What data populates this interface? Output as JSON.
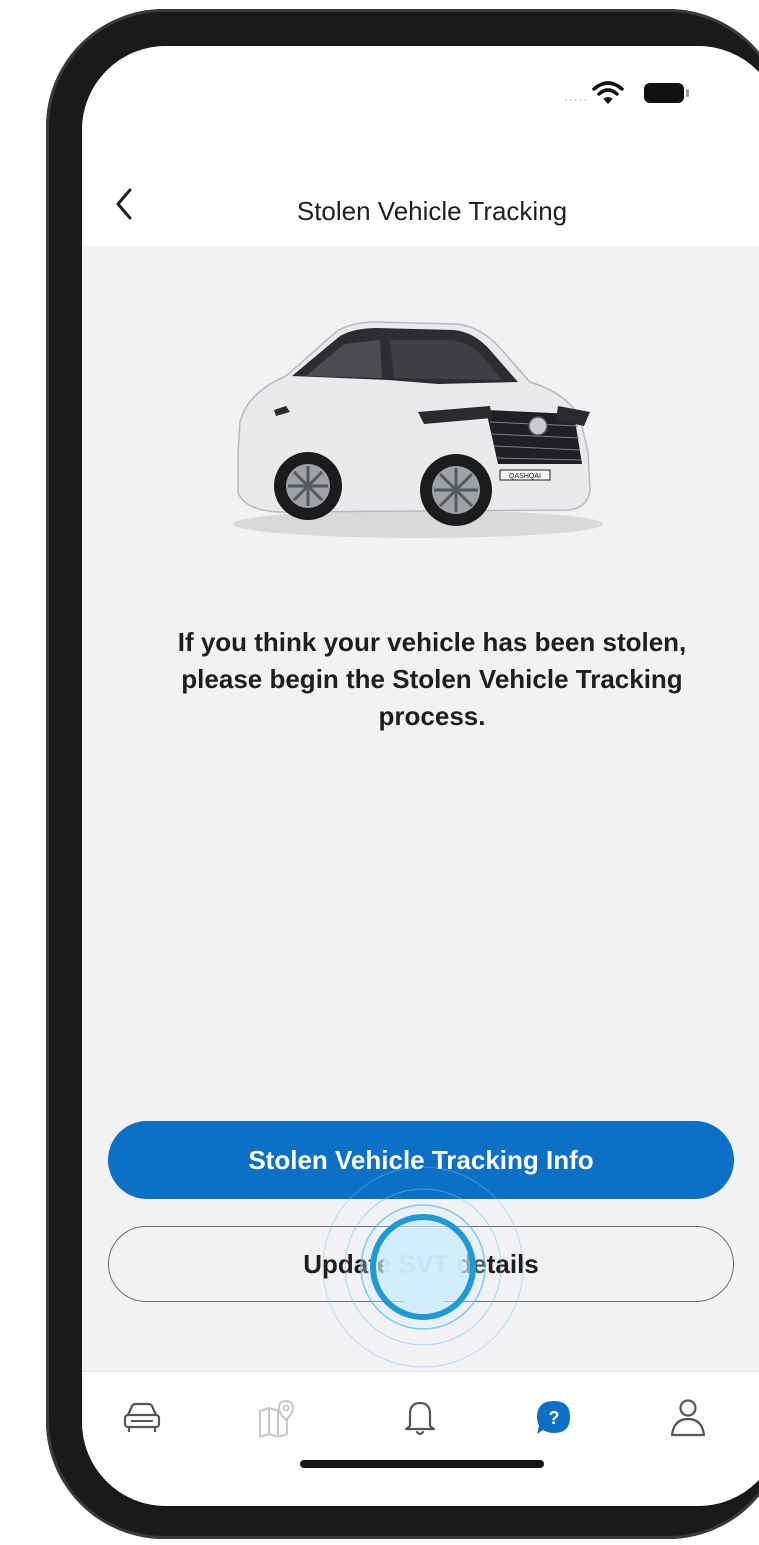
{
  "nav": {
    "title": "Stolen Vehicle Tracking"
  },
  "status": {
    "dots": "....."
  },
  "main": {
    "message": "If you think your vehicle has been stolen, please begin the Stolen Vehicle Tracking process.",
    "car_plate": "QASHQAI"
  },
  "buttons": {
    "primary_label": "Stolen Vehicle Tracking Info",
    "secondary_label": "Update SVT details"
  },
  "tab_bar": {
    "items": [
      {
        "icon": "car-icon",
        "active": false
      },
      {
        "icon": "map-icon",
        "active": false
      },
      {
        "icon": "bell-icon",
        "active": false
      },
      {
        "icon": "help-icon",
        "active": true,
        "glyph": "?"
      },
      {
        "icon": "profile-icon",
        "active": false
      }
    ]
  },
  "colors": {
    "accent": "#0c70c7",
    "background": "#f2f2f4",
    "text": "#1e1e1e"
  }
}
